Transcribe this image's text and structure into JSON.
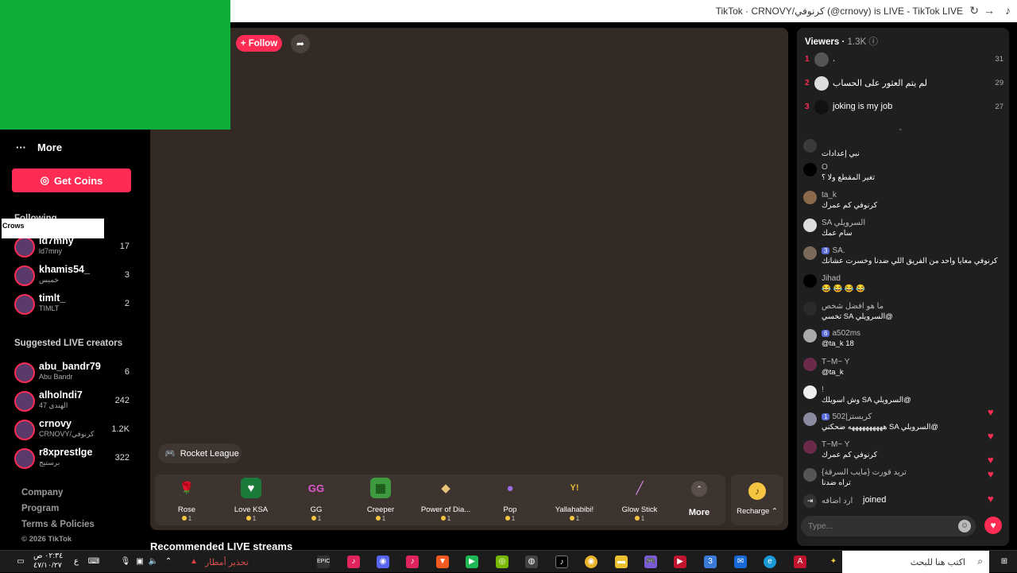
{
  "browser": {
    "title": "TikTok · CRNOVY/كرنوفي (@crnovy) is LIVE - TikTok LIVE"
  },
  "sidebar": {
    "more_label": "More",
    "get_coins_label": "Get Coins",
    "following_title": "Following",
    "crows_label": "Crows",
    "following": [
      {
        "name": "ld7mny",
        "sub": "ld7mny",
        "count": "17"
      },
      {
        "name": "khamis54_",
        "sub": "خميس",
        "count": "3"
      },
      {
        "name": "timlt_",
        "sub": "TIMLT",
        "count": "2"
      }
    ],
    "suggested_title": "Suggested LIVE creators",
    "suggested": [
      {
        "name": "abu_bandr79",
        "sub": "Abu Bandr",
        "count": "6"
      },
      {
        "name": "alholndi7",
        "sub": "47 الهندي",
        "count": "242"
      },
      {
        "name": "crnovy",
        "sub": "CRNOVY/كرنوفي",
        "count": "1.2K"
      },
      {
        "name": "r8xprestlge",
        "sub": "برستيج",
        "count": "322"
      }
    ],
    "footer": [
      "Company",
      "Program",
      "Terms & Policies",
      "© 2026 TikTok"
    ]
  },
  "stream": {
    "follow_label": "+ Follow",
    "game_tag": "Rocket League",
    "recommended_title": "Recommended LIVE streams"
  },
  "gifts": [
    {
      "name": "Rose",
      "price": "1",
      "icon": "rose-icon",
      "glyph": "🌹",
      "color": "#b8324a"
    },
    {
      "name": "Love KSA",
      "price": "1",
      "icon": "love-ksa-icon",
      "glyph": "♥",
      "color": "#1a7a3a"
    },
    {
      "name": "GG",
      "price": "1",
      "icon": "gg-icon",
      "glyph": "GG",
      "color": "#d946c8"
    },
    {
      "name": "Creeper",
      "price": "1",
      "icon": "creeper-icon",
      "glyph": "▦",
      "color": "#3e9a3e"
    },
    {
      "name": "Power of Dia...",
      "price": "1",
      "icon": "diamond-icon",
      "glyph": "◆",
      "color": "#c9a25a"
    },
    {
      "name": "Pop",
      "price": "1",
      "icon": "pop-icon",
      "glyph": "●",
      "color": "#7a4dc9"
    },
    {
      "name": "Yallahabibi!",
      "price": "1",
      "icon": "yallahabibi-icon",
      "glyph": "Y!",
      "color": "#d6a92a"
    },
    {
      "name": "Glow Stick",
      "price": "1",
      "icon": "glow-stick-icon",
      "glyph": "/",
      "color": "#c87ad6"
    }
  ],
  "more_gifts_label": "More",
  "recharge_label": "Recharge",
  "viewers": {
    "title": "Viewers",
    "count": "1.3K",
    "top": [
      {
        "rank": "1",
        "name": ".",
        "score": "31"
      },
      {
        "rank": "2",
        "name": "لم يتم العثور على الحساب",
        "score": "29"
      },
      {
        "rank": "3",
        "name": "joking is my job",
        "score": "27"
      }
    ]
  },
  "chat": [
    {
      "name": "",
      "badge": "",
      "text": "نبي إعدادات"
    },
    {
      "name": "O",
      "badge": "",
      "text": "تغير المقطع ولا ؟"
    },
    {
      "name": "ta_k",
      "badge": "",
      "text": "كرنوفي كم عمرك"
    },
    {
      "name": "SA السرويلي",
      "badge": "",
      "text": "سام عمك"
    },
    {
      "name": "SA.",
      "badge": "3",
      "text": "كرنوفي معايا واحد من الفريق اللي ضدنا وخسرت عشانك"
    },
    {
      "name": "Jihad",
      "badge": "",
      "text": "😂 😂 😂 😂"
    },
    {
      "name": "ما هو افضل شخص",
      "badge": "",
      "text": "تخسي SA السرويلي@"
    },
    {
      "name": "a502ms",
      "badge": "6",
      "text": "@ta_k 18"
    },
    {
      "name": "T~M~ Y",
      "badge": "",
      "text": "@ta_k"
    },
    {
      "name": "!",
      "badge": "",
      "text": "وش اسويلك SA السرويلي@"
    },
    {
      "name": "كريستز|502",
      "badge": "1",
      "text": "ههههههههههه ضحكني SA السرويلي@"
    },
    {
      "name": "T~M~ Y",
      "badge": "",
      "text": "كرنوفي كم عمرك"
    },
    {
      "name": "تريد قورت {مايب السرقة}",
      "badge": "",
      "text": "تراه ضدنا"
    },
    {
      "name": "ارد اضافه",
      "badge": "",
      "text": "joined"
    }
  ],
  "chat_input_placeholder": "Type...",
  "taskbar": {
    "weather": "تحذير أمطار",
    "search": "اكتب هنا للبحث",
    "time": "٠٢:٣٤ ص",
    "date": "٤٧/١٠/٢٧"
  }
}
